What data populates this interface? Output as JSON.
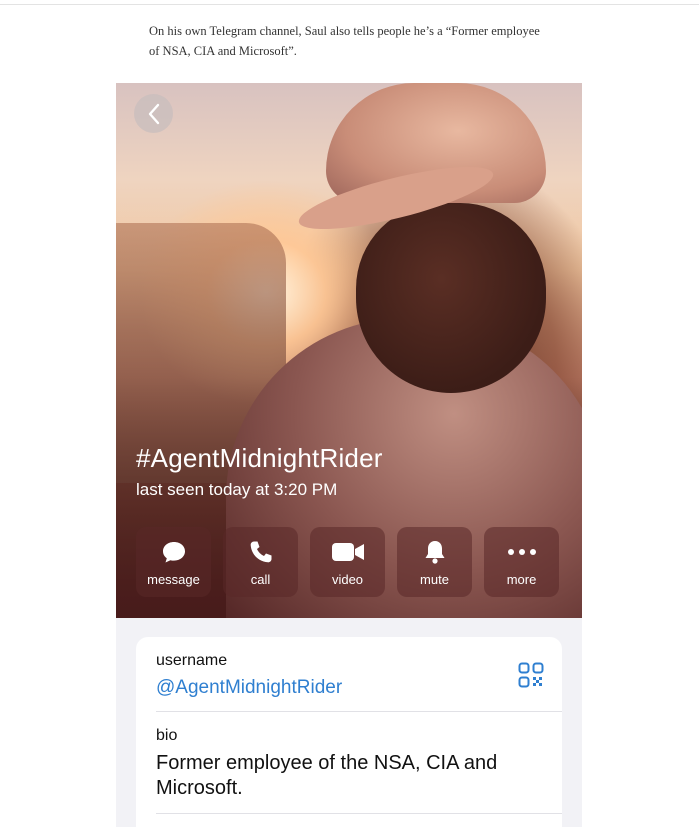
{
  "article": {
    "paragraph": "On his own Telegram channel, Saul also tells people he’s a “Former employee of NSA, CIA and Microsoft”."
  },
  "profile": {
    "name": "#AgentMidnightRider",
    "status": "last seen today at 3:20 PM",
    "actions": [
      {
        "label": "message",
        "icon": "message-icon"
      },
      {
        "label": "call",
        "icon": "phone-icon"
      },
      {
        "label": "video",
        "icon": "video-icon"
      },
      {
        "label": "mute",
        "icon": "bell-icon"
      },
      {
        "label": "more",
        "icon": "more-icon"
      }
    ]
  },
  "info": {
    "username_label": "username",
    "username_value": "@AgentMidnightRider",
    "bio_label": "bio",
    "bio_value": "Former employee of the NSA, CIA and Microsoft."
  },
  "colors": {
    "link": "#2f7fd0",
    "panel_bg": "#f2f2f6"
  }
}
